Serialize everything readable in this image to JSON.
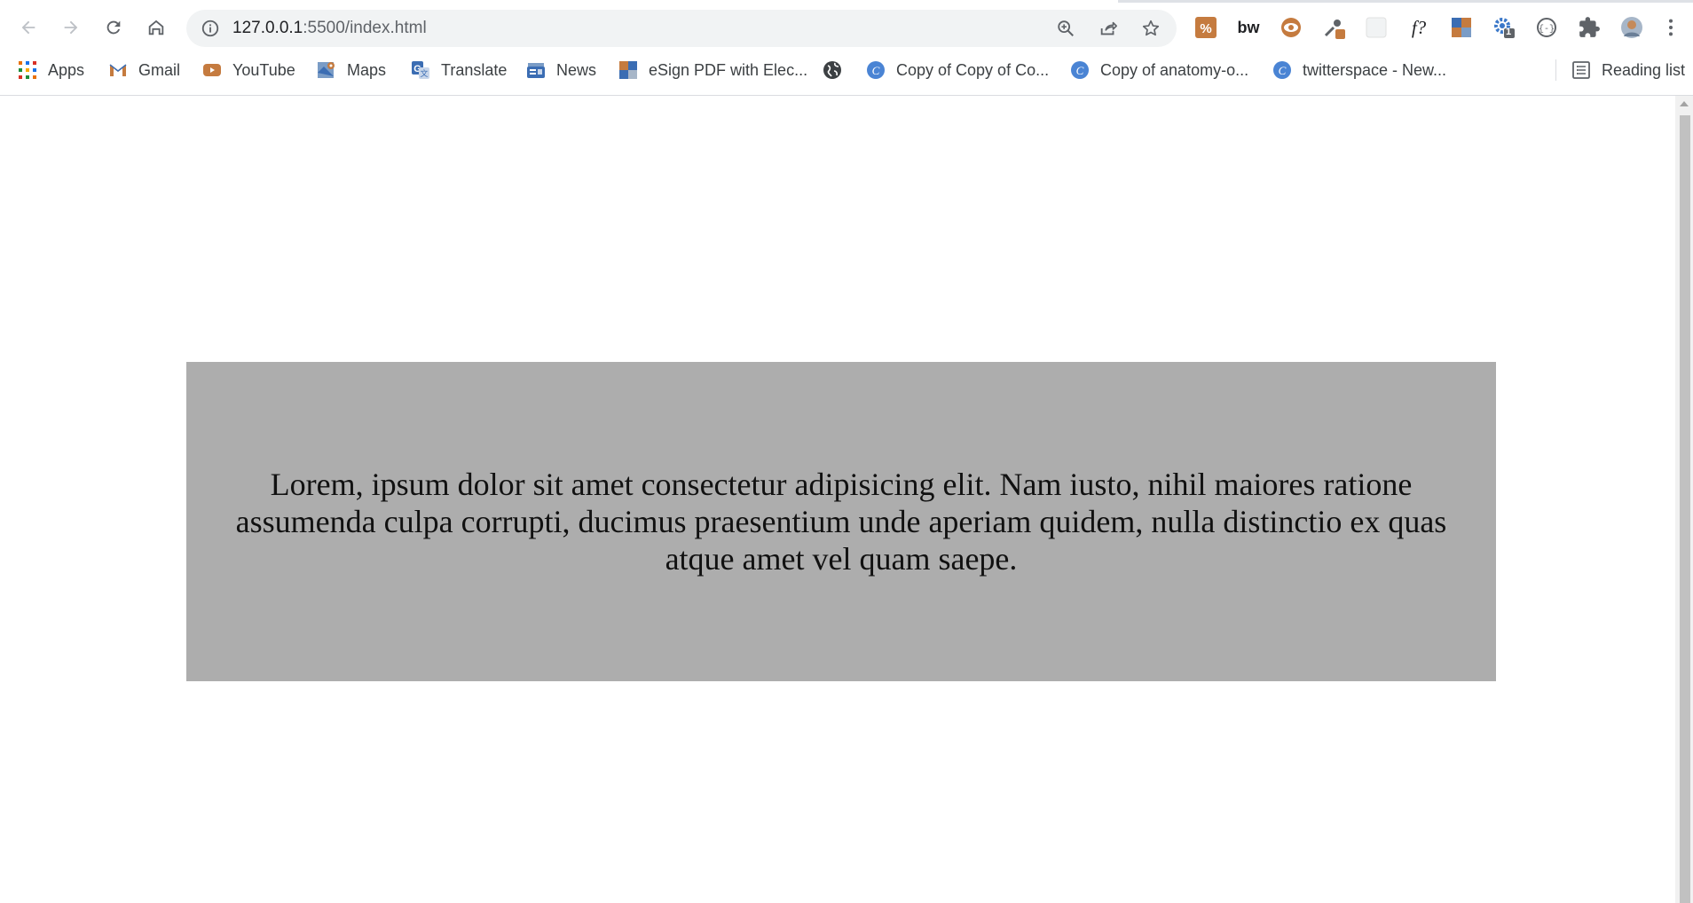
{
  "browser": {
    "url_host": "127.0.0.1",
    "url_rest": ":5500/index.html",
    "extensions": [
      {
        "name": "percent-extension-icon"
      },
      {
        "name": "bw-extension-icon",
        "text": "bw"
      },
      {
        "name": "eye-extension-icon"
      },
      {
        "name": "eyedropper-extension-icon"
      },
      {
        "name": "blank-extension-icon"
      },
      {
        "name": "whatfont-extension-icon",
        "text": "f?"
      },
      {
        "name": "colorzilla-extension-icon"
      },
      {
        "name": "gear-extension-icon",
        "badge": "1"
      },
      {
        "name": "code-extension-icon"
      },
      {
        "name": "puzzle-icon"
      }
    ]
  },
  "bookmarks": {
    "apps": "Apps",
    "gmail": "Gmail",
    "youtube": "YouTube",
    "maps": "Maps",
    "translate": "Translate",
    "news": "News",
    "esign": "eSign PDF with Elec...",
    "copy1": "Copy of Copy of Co...",
    "copy2": "Copy of anatomy-o...",
    "twitterspace": "twitterspace - New...",
    "reading_list": "Reading list"
  },
  "page": {
    "paragraph": "Lorem, ipsum dolor sit amet consectetur adipisicing elit. Nam iusto, nihil maiores ratione assumenda culpa corrupti, ducimus praesentium unde aperiam quidem, nulla distinctio ex quas atque amet vel quam saepe."
  },
  "colors": {
    "panel_background": "#adadad",
    "page_background": "#ffffff",
    "omnibox_background": "#f1f3f4"
  }
}
